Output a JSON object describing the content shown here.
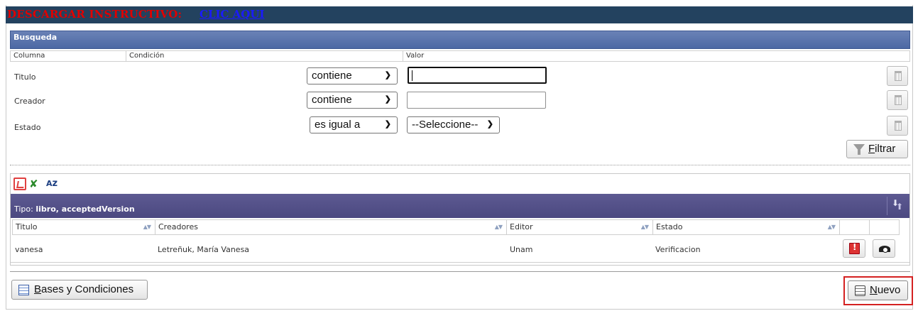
{
  "banner": {
    "prefix": "DESCARGAR INSTRUCTIVO:",
    "link": "CLIC AQUI"
  },
  "search": {
    "title": "Busqueda",
    "columns": [
      "Columna",
      "Condición",
      "Valor"
    ],
    "rows": [
      {
        "label": "Titulo",
        "condition": "contiene",
        "value": ""
      },
      {
        "label": "Creador",
        "condition": "contiene",
        "value": ""
      },
      {
        "label": "Estado",
        "condition": "es igual a",
        "value": "--Seleccione--"
      }
    ],
    "filter_button": "Filtrar"
  },
  "results": {
    "toolbar": {
      "export_pdf_icon": "pdf-icon",
      "export_excel_icon": "excel-icon",
      "sort_icon": "sort-az-icon"
    },
    "tipo_label": "Tipo:",
    "tipo_value": "libro, acceptedVersion",
    "headers": [
      "Titulo",
      "Creadores",
      "Editor",
      "Estado"
    ],
    "rows": [
      {
        "titulo": "vanesa",
        "creadores": "Letreñuk, María Vanesa",
        "editor": "Unam",
        "estado": "Verificacion"
      }
    ]
  },
  "footer": {
    "bases_button": "Bases y Condiciones",
    "nuevo_button": "Nuevo"
  },
  "colors": {
    "banner_bg": "#23425f",
    "banner_text": "#e00000",
    "banner_link": "#1a1aff",
    "search_header": "#5670a8",
    "results_header": "#524f88",
    "highlight": "#d42121"
  }
}
